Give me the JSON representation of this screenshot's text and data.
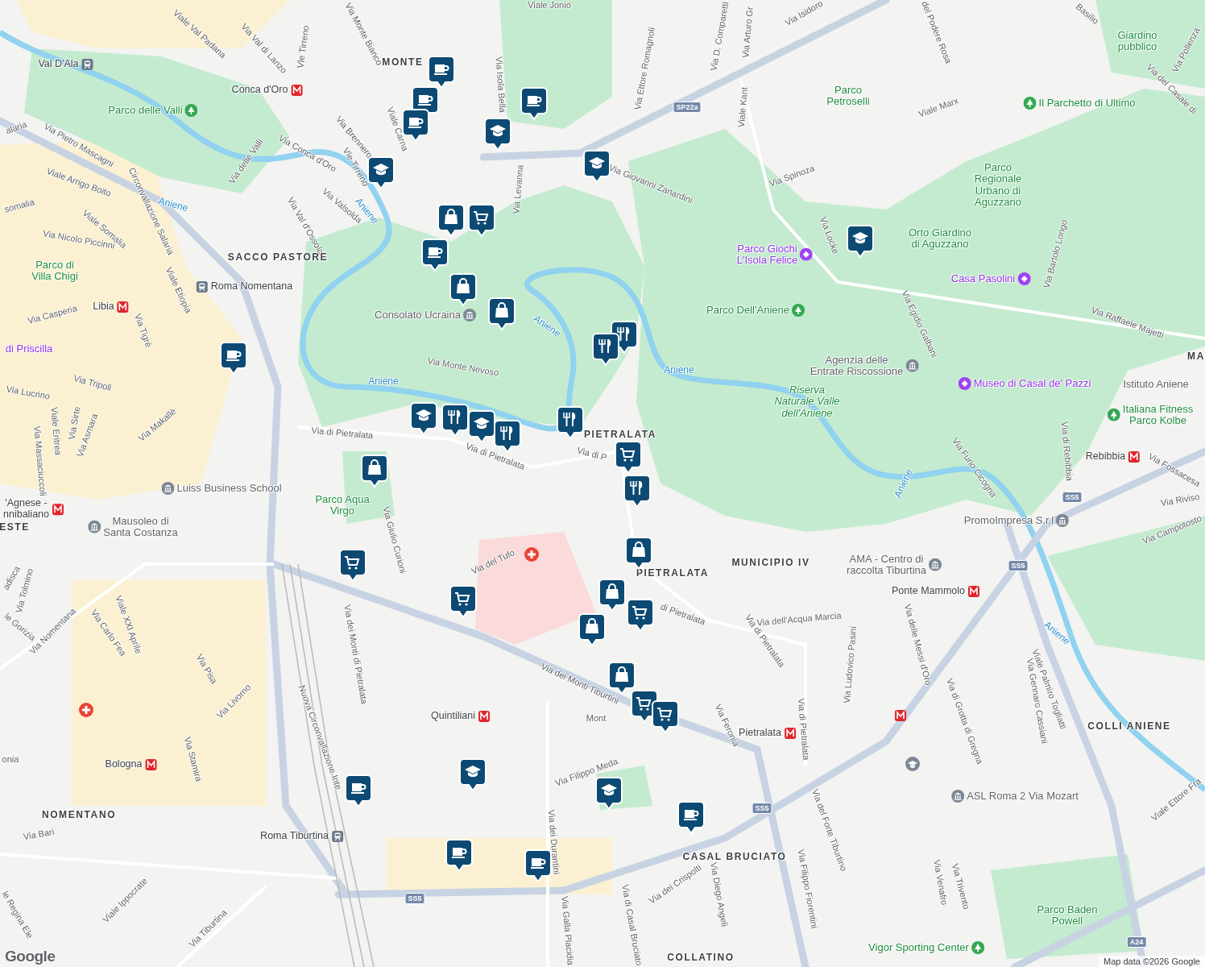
{
  "map": {
    "labels": [
      {
        "text": "Viale Jonio",
        "kind": "street"
      },
      {
        "text": "Via Val di Lanzo",
        "kind": "street"
      },
      {
        "text": "Viale Val Padana",
        "kind": "street"
      },
      {
        "text": "Via Monte Bianco",
        "kind": "street"
      },
      {
        "text": "Vle Tirreno",
        "kind": "street"
      },
      {
        "text": "MONTE",
        "kind": "district"
      },
      {
        "text": "Via Isola Bella",
        "kind": "street"
      },
      {
        "text": "Via Ettore Romagnoli",
        "kind": "street"
      },
      {
        "text": "Via D. Comparetti",
        "kind": "street"
      },
      {
        "text": "Via Arturo Gr",
        "kind": "street"
      },
      {
        "text": "Via Isidoro",
        "kind": "street"
      },
      {
        "text": "del Podere Rosa",
        "kind": "street"
      },
      {
        "text": "Basilio",
        "kind": "street"
      },
      {
        "text": "Giardino\npubblico",
        "kind": "park"
      },
      {
        "text": "Via Pollenza",
        "kind": "street"
      },
      {
        "text": "Via del Casale di",
        "kind": "street"
      },
      {
        "text": "Parco\nPetroselli",
        "kind": "park"
      },
      {
        "text": "Viale Kant",
        "kind": "street"
      },
      {
        "text": "Viale Marx",
        "kind": "street"
      },
      {
        "text": "Il Parchetto di Ultimo",
        "kind": "parkpoilead"
      },
      {
        "text": "Via Giovanni Zanardini",
        "kind": "street"
      },
      {
        "text": "Via Spinoza",
        "kind": "street"
      },
      {
        "text": "Parco\nRegionale\nUrbano di\nAguzzano",
        "kind": "park"
      },
      {
        "text": "Via Locke",
        "kind": "street"
      },
      {
        "text": "Orto Giardino\ndi Aguzzano",
        "kind": "park"
      },
      {
        "text": "Via Bartolo Longo",
        "kind": "street"
      },
      {
        "text": "Parco Giochi\nL'Isola Felice",
        "kind": "attraction"
      },
      {
        "text": "Casa Pasolini",
        "kind": "attraction"
      },
      {
        "text": "Parco Dell'Aniene",
        "kind": "parkpoi"
      },
      {
        "text": "Via Egidio Galbani",
        "kind": "street"
      },
      {
        "text": "Via Raffaele Majetti",
        "kind": "street"
      },
      {
        "text": "Agenzia delle\nEntrate Riscossione",
        "kind": "place"
      },
      {
        "text": "Museo di Casal de' Pazzi",
        "kind": "attractionlead"
      },
      {
        "text": "Istituto Aniene",
        "kind": "placetext"
      },
      {
        "text": "MA",
        "kind": "district"
      },
      {
        "text": "Riserva\nNaturale Valle\ndell'Aniene",
        "kind": "reserve"
      },
      {
        "text": "Italiana Fitness\nParco Kolbe",
        "kind": "parkpoilead"
      },
      {
        "text": "Rebibbia",
        "kind": "metro"
      },
      {
        "text": "Via Furio Cicogna",
        "kind": "street"
      },
      {
        "text": "Via di Rebibbia",
        "kind": "street"
      },
      {
        "text": "Via Fossacesa",
        "kind": "street"
      },
      {
        "text": "Via Riviso",
        "kind": "street"
      },
      {
        "text": "Via Campotosto",
        "kind": "street"
      },
      {
        "text": "PromoImpresa S.r.l",
        "kind": "place"
      },
      {
        "text": "Aniene",
        "kind": "river"
      },
      {
        "text": "Aniene",
        "kind": "river"
      },
      {
        "text": "Aniene",
        "kind": "river"
      },
      {
        "text": "Aniene",
        "kind": "river"
      },
      {
        "text": "Aniene",
        "kind": "river"
      },
      {
        "text": "Aniene",
        "kind": "river"
      },
      {
        "text": "Aniene",
        "kind": "river"
      },
      {
        "text": "MUNICIPIO IV",
        "kind": "district"
      },
      {
        "text": "AMA - Centro di\nraccolta Tiburtina",
        "kind": "place"
      },
      {
        "text": "Ponte Mammolo",
        "kind": "metro"
      },
      {
        "text": "Val D'Ala",
        "kind": "station"
      },
      {
        "text": "Conca d'Oro",
        "kind": "metro"
      },
      {
        "text": "Parco delle Valli",
        "kind": "parkpoi"
      },
      {
        "text": "Via Pietro Mascagni",
        "kind": "street"
      },
      {
        "text": "alaria",
        "kind": "street"
      },
      {
        "text": "Viale Carna",
        "kind": "street"
      },
      {
        "text": "Via Brennero",
        "kind": "street"
      },
      {
        "text": "Vle Tirreno",
        "kind": "street"
      },
      {
        "text": "Via Conca d'Oro",
        "kind": "street"
      },
      {
        "text": "Via delle Valli",
        "kind": "street"
      },
      {
        "text": "Viale Arrigo Boito",
        "kind": "street"
      },
      {
        "text": "Circonvallazione Salaria",
        "kind": "street"
      },
      {
        "text": "Via Valsolda",
        "kind": "street"
      },
      {
        "text": "Via Val d'Ossola",
        "kind": "street"
      },
      {
        "text": "Via Levanna",
        "kind": "street"
      },
      {
        "text": "somalia",
        "kind": "street"
      },
      {
        "text": "Viale Somalia",
        "kind": "street"
      },
      {
        "text": "Via Nicolo Piccinni",
        "kind": "street"
      },
      {
        "text": "SACCO PASTORE",
        "kind": "district"
      },
      {
        "text": "Parco di\nVilla Chigi",
        "kind": "park"
      },
      {
        "text": "Viale Etiopia",
        "kind": "street"
      },
      {
        "text": "Roma Nomentana",
        "kind": "stationlead"
      },
      {
        "text": "Libia",
        "kind": "metro"
      },
      {
        "text": "Via Casperia",
        "kind": "street"
      },
      {
        "text": "Via Tigrè",
        "kind": "street"
      },
      {
        "text": "Consolato Ucraina",
        "kind": "place"
      },
      {
        "text": "di Priscilla",
        "kind": "attractiontext"
      },
      {
        "text": "Via Monte Nevoso",
        "kind": "street"
      },
      {
        "text": "Via Tripoli",
        "kind": "street"
      },
      {
        "text": "Via Lucrino",
        "kind": "street"
      },
      {
        "text": "Via Makallè",
        "kind": "street"
      },
      {
        "text": "Viale Eritrea",
        "kind": "street"
      },
      {
        "text": "Via Sirte",
        "kind": "street"
      },
      {
        "text": "Via Asmara",
        "kind": "street"
      },
      {
        "text": "Via Massaciuccoli",
        "kind": "street"
      },
      {
        "text": "Via di Pietralata",
        "kind": "street"
      },
      {
        "text": "Via di Pietralata",
        "kind": "street"
      },
      {
        "text": "PIETRALATA",
        "kind": "district"
      },
      {
        "text": "Via di P",
        "kind": "street"
      },
      {
        "text": "Luiss Business School",
        "kind": "placelead"
      },
      {
        "text": "'Agnese -\nnnibaliano",
        "kind": "metro"
      },
      {
        "text": "Parco Aqua\nVirgo",
        "kind": "park"
      },
      {
        "text": "ESTE",
        "kind": "district"
      },
      {
        "text": "Mausoleo di\nSanta Costanza",
        "kind": "placelead"
      },
      {
        "text": "Via Giulio Curioni",
        "kind": "street"
      },
      {
        "text": "Via del Tufo",
        "kind": "street"
      },
      {
        "text": "PIETRALATA",
        "kind": "district"
      },
      {
        "text": "di Pietralata",
        "kind": "street"
      },
      {
        "text": "Via di Pietralata",
        "kind": "street"
      },
      {
        "text": "Via dell'Acqua Marcia",
        "kind": "street"
      },
      {
        "text": "Via Ludovico Pasini",
        "kind": "street"
      },
      {
        "text": "Via delle Messi d'Oro",
        "kind": "street"
      },
      {
        "text": "Via dei Monti di Pietralata",
        "kind": "street"
      },
      {
        "text": "Via dei Monti Tiburtini",
        "kind": "street"
      },
      {
        "text": "Mont",
        "kind": "street"
      },
      {
        "text": "Quintiliani",
        "kind": "metro"
      },
      {
        "text": "Via Feronia",
        "kind": "street"
      },
      {
        "text": "Pietralata",
        "kind": "metro"
      },
      {
        "text": "Via di Pietralata",
        "kind": "street"
      },
      {
        "text": "Viale Palmiro Togliatti",
        "kind": "street"
      },
      {
        "text": "Via Gennaro Cassiani",
        "kind": "street"
      },
      {
        "text": "Via di Grotta di Gregna",
        "kind": "street"
      },
      {
        "text": "COLLI ANIENE",
        "kind": "district"
      },
      {
        "text": "ASL Roma 2 Via Mozart",
        "kind": "placelead"
      },
      {
        "text": "Viale Ettore Fra",
        "kind": "street"
      },
      {
        "text": "Via del Forte Tiburtino",
        "kind": "street"
      },
      {
        "text": "Nuova Circonvallazione Inte",
        "kind": "street"
      },
      {
        "text": "Via Filippo Meda",
        "kind": "street"
      },
      {
        "text": "Via dei Durantini",
        "kind": "street"
      },
      {
        "text": "CASAL BRUCIATO",
        "kind": "district"
      },
      {
        "text": "Via Filippo Fiorentini",
        "kind": "street"
      },
      {
        "text": "Via Diego Angeli",
        "kind": "street"
      },
      {
        "text": "Via dei Crispolti",
        "kind": "street"
      },
      {
        "text": "Via di Casal Bruciato",
        "kind": "street"
      },
      {
        "text": "Via Galla Placidia",
        "kind": "street"
      },
      {
        "text": "Via Venafro",
        "kind": "street"
      },
      {
        "text": "Via Trivento",
        "kind": "street"
      },
      {
        "text": "Parco Baden\nPowell",
        "kind": "park"
      },
      {
        "text": "Vigor Sporting Center",
        "kind": "parkpoi"
      },
      {
        "text": "COLLATINO",
        "kind": "district"
      },
      {
        "text": "NOMENTANO",
        "kind": "district"
      },
      {
        "text": "Roma Tiburtina",
        "kind": "station"
      },
      {
        "text": "Bologna",
        "kind": "metro"
      },
      {
        "text": "Via Bari",
        "kind": "street"
      },
      {
        "text": "Viale Ippocrate",
        "kind": "street"
      },
      {
        "text": "Via Tiburtina",
        "kind": "street"
      },
      {
        "text": "le Regina Ele",
        "kind": "street"
      },
      {
        "text": "Via Tolmino",
        "kind": "street"
      },
      {
        "text": "Via Nomentana",
        "kind": "street"
      },
      {
        "text": "Viale XXI Aprile",
        "kind": "street"
      },
      {
        "text": "Via Carlo Fea",
        "kind": "street"
      },
      {
        "text": "Via Pisa",
        "kind": "street"
      },
      {
        "text": "Via Livorno",
        "kind": "street"
      },
      {
        "text": "Via Stamira",
        "kind": "street"
      },
      {
        "text": "le Gorizia",
        "kind": "street"
      },
      {
        "text": "adisca",
        "kind": "street"
      },
      {
        "text": "onia",
        "kind": "street"
      }
    ],
    "road_shields": [
      {
        "text": "SP22a"
      },
      {
        "text": "SS5"
      },
      {
        "text": "SS5"
      },
      {
        "text": "SS5"
      },
      {
        "text": "SS5"
      },
      {
        "text": "A24"
      }
    ],
    "pins": [
      {
        "kind": "coffee"
      },
      {
        "kind": "coffee"
      },
      {
        "kind": "coffee"
      },
      {
        "kind": "coffee"
      },
      {
        "kind": "coffee"
      },
      {
        "kind": "coffee"
      },
      {
        "kind": "coffee"
      },
      {
        "kind": "coffee"
      },
      {
        "kind": "coffee"
      },
      {
        "kind": "coffee"
      },
      {
        "kind": "school"
      },
      {
        "kind": "school"
      },
      {
        "kind": "school"
      },
      {
        "kind": "school"
      },
      {
        "kind": "school"
      },
      {
        "kind": "school"
      },
      {
        "kind": "school"
      },
      {
        "kind": "school"
      },
      {
        "kind": "shopping"
      },
      {
        "kind": "shopping"
      },
      {
        "kind": "shopping"
      },
      {
        "kind": "shopping"
      },
      {
        "kind": "shopping"
      },
      {
        "kind": "shopping"
      },
      {
        "kind": "shopping"
      },
      {
        "kind": "shopping"
      },
      {
        "kind": "restaurant"
      },
      {
        "kind": "restaurant"
      },
      {
        "kind": "restaurant"
      },
      {
        "kind": "restaurant"
      },
      {
        "kind": "restaurant"
      },
      {
        "kind": "restaurant"
      },
      {
        "kind": "cart"
      },
      {
        "kind": "cart"
      },
      {
        "kind": "cart"
      },
      {
        "kind": "cart"
      },
      {
        "kind": "cart"
      },
      {
        "kind": "cart"
      },
      {
        "kind": "cart"
      }
    ]
  },
  "attribution": {
    "logo": "Google",
    "text": "Map data ©2026 Google"
  }
}
